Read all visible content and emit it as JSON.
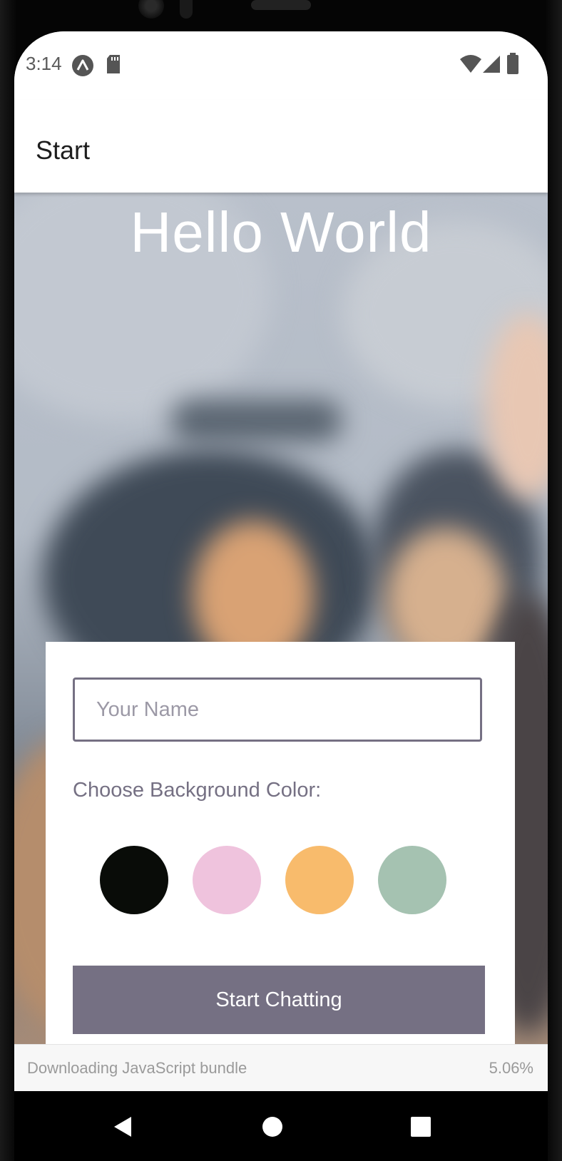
{
  "status_bar": {
    "time": "3:14",
    "left_icons": [
      "expo-icon",
      "sd-card-icon"
    ],
    "right_icons": [
      "wifi-icon",
      "signal-icon",
      "battery-icon"
    ]
  },
  "app_bar": {
    "title": "Start"
  },
  "hero": {
    "title": "Hello World"
  },
  "form": {
    "name_placeholder": "Your Name",
    "name_value": "",
    "choose_label": "Choose Background Color:",
    "colors": [
      "#090C08",
      "#EFC3DD",
      "#F8BB6C",
      "#A5C2B1"
    ],
    "start_button": "Start Chatting"
  },
  "download_bar": {
    "message": "Downloading JavaScript bundle",
    "progress": "5.06%"
  },
  "nav_bar": {
    "buttons": [
      "back-icon",
      "home-icon",
      "recents-icon"
    ]
  }
}
